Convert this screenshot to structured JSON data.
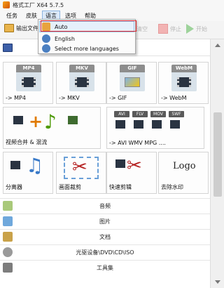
{
  "window": {
    "title": "格式工厂 X64 5.7.5"
  },
  "menu": {
    "items": [
      "任务",
      "皮肤",
      "语言",
      "选项",
      "帮助"
    ],
    "active_index": 2
  },
  "toolbar": {
    "output_folder": "输出文件夹",
    "clear_list": "清空",
    "stop": "停止",
    "start": "开始"
  },
  "language_menu": {
    "items": [
      {
        "label": "Auto",
        "selected": true
      },
      {
        "label": "English",
        "selected": false
      },
      {
        "label": "Select more languages",
        "selected": false
      }
    ]
  },
  "video_panel": {
    "tiles": [
      {
        "label": "-> MP4",
        "format": "MP4",
        "color": "#8d8d8d"
      },
      {
        "label": "-> MKV",
        "format": "MKV",
        "color": "#8d8d8d"
      },
      {
        "label": "-> GIF",
        "format": "GIF",
        "color": "#8d8d8d"
      },
      {
        "label": "-> WebM",
        "format": "WebM",
        "color": "#8d8d8d"
      }
    ],
    "merge_label": "视频合并 & 混流",
    "multi_format_label": "-> AVI WMV MPG ....",
    "multi_format_chips": [
      "AVI",
      "FLV",
      "MOV",
      "SWF"
    ],
    "tools": [
      {
        "label": "分离器",
        "icon": "splitter-icon"
      },
      {
        "label": "画面裁剪",
        "icon": "crop-icon"
      },
      {
        "label": "快速剪辑",
        "icon": "quick-clip-icon"
      },
      {
        "label": "去除水印",
        "icon": "remove-watermark-icon"
      }
    ],
    "watermark_logo_text": "Logo"
  },
  "categories": [
    {
      "label": "音频",
      "icon": "audio-icon",
      "color": "#a9c97a"
    },
    {
      "label": "图片",
      "icon": "picture-icon",
      "color": "#6fa8dc"
    },
    {
      "label": "文档",
      "icon": "document-icon",
      "color": "#c9a24a"
    },
    {
      "label": "光驱设备\\DVD\\CD\\ISO",
      "icon": "disc-icon",
      "color": "#9a9a9a"
    },
    {
      "label": "工具集",
      "icon": "toolbox-icon",
      "color": "#7d7d7d"
    }
  ]
}
